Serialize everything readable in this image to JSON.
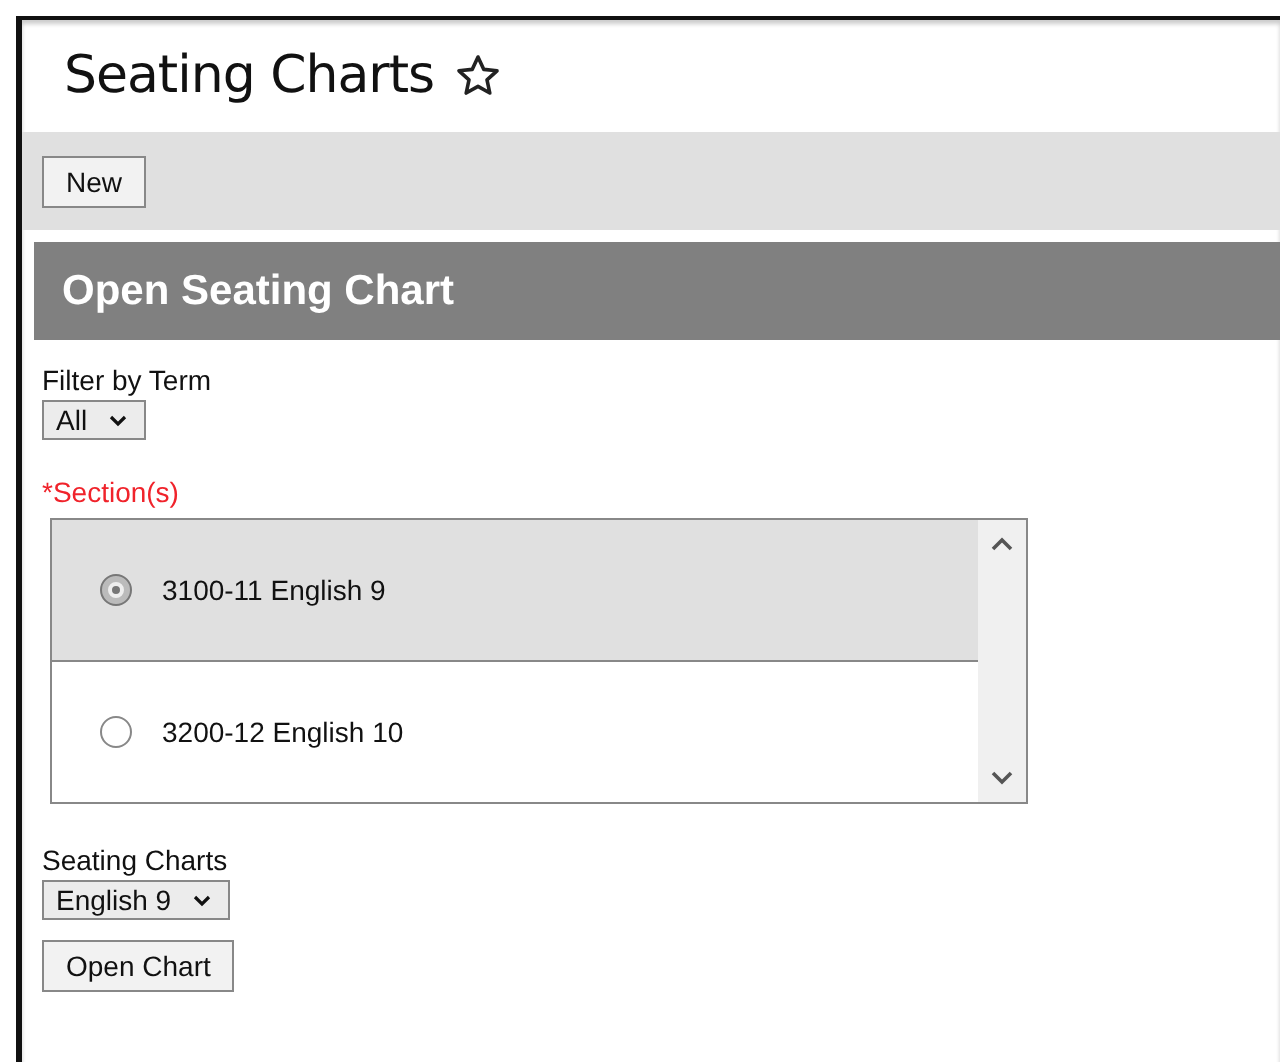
{
  "page": {
    "title": "Seating Charts",
    "favorite": false
  },
  "toolbar": {
    "buttons": [
      "New"
    ]
  },
  "panel": {
    "title": "Open Seating Chart"
  },
  "filter": {
    "label": "Filter by Term",
    "value": "All"
  },
  "sections": {
    "label": "*Section(s)",
    "required": true,
    "items": [
      {
        "label": "3100-11 English 9",
        "selected": true
      },
      {
        "label": "3200-12 English 10",
        "selected": false
      }
    ]
  },
  "seating_charts": {
    "label": "Seating Charts",
    "value": "English 9"
  },
  "action": {
    "label": "Open Chart"
  }
}
